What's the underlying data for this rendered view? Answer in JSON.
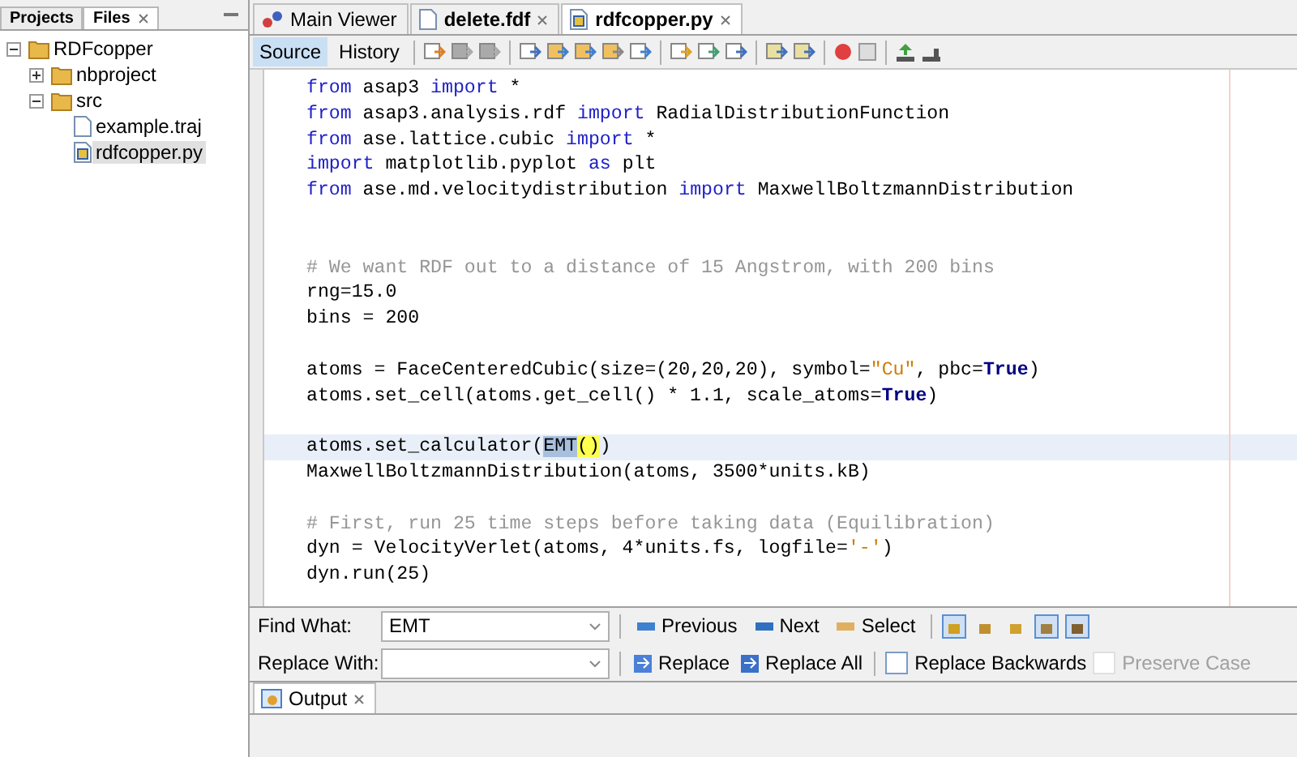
{
  "sidebar": {
    "tabs": [
      {
        "label": "Projects",
        "selected": false,
        "closable": false
      },
      {
        "label": "Files",
        "selected": true,
        "closable": true
      }
    ],
    "tree": [
      {
        "label": "RDFcopper",
        "kind": "folder",
        "expanded": true,
        "selected": false,
        "children": [
          {
            "label": "nbproject",
            "kind": "folder",
            "expanded": false,
            "selected": false
          },
          {
            "label": "src",
            "kind": "folder",
            "expanded": true,
            "selected": false,
            "children": [
              {
                "label": "example.traj",
                "kind": "file",
                "selected": false
              },
              {
                "label": "rdfcopper.py",
                "kind": "python",
                "selected": true
              }
            ]
          }
        ]
      }
    ]
  },
  "editor_tabs": [
    {
      "label": "Main Viewer",
      "kind": "viewer",
      "selected": false
    },
    {
      "label": "delete.fdf",
      "kind": "file",
      "selected": false
    },
    {
      "label": "rdfcopper.py",
      "kind": "python",
      "selected": true
    }
  ],
  "view_tabs": [
    {
      "label": "Source",
      "selected": true
    },
    {
      "label": "History",
      "selected": false
    }
  ],
  "code": [
    {
      "current": false,
      "segments": [
        {
          "kind": "kw",
          "text": "from"
        },
        {
          "kind": "plain",
          "text": " asap3 "
        },
        {
          "kind": "kw",
          "text": "import"
        },
        {
          "kind": "plain",
          "text": " *"
        }
      ]
    },
    {
      "current": false,
      "segments": [
        {
          "kind": "kw",
          "text": "from"
        },
        {
          "kind": "plain",
          "text": " asap3.analysis.rdf "
        },
        {
          "kind": "kw",
          "text": "import"
        },
        {
          "kind": "plain",
          "text": " RadialDistributionFunction"
        }
      ]
    },
    {
      "current": false,
      "segments": [
        {
          "kind": "kw",
          "text": "from"
        },
        {
          "kind": "plain",
          "text": " ase.lattice.cubic "
        },
        {
          "kind": "kw",
          "text": "import"
        },
        {
          "kind": "plain",
          "text": " *"
        }
      ]
    },
    {
      "current": false,
      "segments": [
        {
          "kind": "kw",
          "text": "import"
        },
        {
          "kind": "plain",
          "text": " matplotlib.pyplot "
        },
        {
          "kind": "kw",
          "text": "as"
        },
        {
          "kind": "plain",
          "text": " plt"
        }
      ]
    },
    {
      "current": false,
      "segments": [
        {
          "kind": "kw",
          "text": "from"
        },
        {
          "kind": "plain",
          "text": " ase.md.velocitydistribution "
        },
        {
          "kind": "kw",
          "text": "import"
        },
        {
          "kind": "plain",
          "text": " MaxwellBoltzmannDistribution"
        }
      ]
    },
    {
      "current": false
    },
    {
      "current": false
    },
    {
      "current": false,
      "segments": [
        {
          "kind": "comment",
          "text": "# We want RDF out to a distance of 15 Angstrom, with 200 bins"
        }
      ]
    },
    {
      "current": false,
      "segments": [
        {
          "kind": "plain",
          "text": "rng=15.0"
        }
      ]
    },
    {
      "current": false,
      "segments": [
        {
          "kind": "plain",
          "text": "bins = 200"
        }
      ]
    },
    {
      "current": false
    },
    {
      "current": false,
      "segments": [
        {
          "kind": "plain",
          "text": "atoms = FaceCenteredCubic(size=(20,20,20), symbol="
        },
        {
          "kind": "string",
          "text": "\"Cu\""
        },
        {
          "kind": "plain",
          "text": ", pbc="
        },
        {
          "kind": "bool",
          "text": "True"
        },
        {
          "kind": "plain",
          "text": ")"
        }
      ]
    },
    {
      "current": false,
      "segments": [
        {
          "kind": "plain",
          "text": "atoms.set_cell(atoms.get_cell() * 1.1, scale_atoms="
        },
        {
          "kind": "bool",
          "text": "True"
        },
        {
          "kind": "plain",
          "text": ")"
        }
      ]
    },
    {
      "current": false
    },
    {
      "current": true,
      "segments": [
        {
          "kind": "plain",
          "text": "atoms.set_calculator("
        },
        {
          "kind": "match",
          "text": "EMT"
        },
        {
          "kind": "brace",
          "text": "()"
        },
        {
          "kind": "plain",
          "text": ")"
        }
      ]
    },
    {
      "current": false,
      "segments": [
        {
          "kind": "plain",
          "text": "MaxwellBoltzmannDistribution(atoms, 3500*units.kB)"
        }
      ]
    },
    {
      "current": false
    },
    {
      "current": false,
      "segments": [
        {
          "kind": "comment",
          "text": "# First, run 25 time steps before taking data (Equilibration)"
        }
      ]
    },
    {
      "current": false,
      "segments": [
        {
          "kind": "plain",
          "text": "dyn = VelocityVerlet(atoms, 4*units.fs, logfile="
        },
        {
          "kind": "string",
          "text": "'-'"
        },
        {
          "kind": "plain",
          "text": ")"
        }
      ]
    },
    {
      "current": false,
      "segments": [
        {
          "kind": "plain",
          "text": "dyn.run(25)"
        }
      ]
    }
  ],
  "find_bar": {
    "find_label": "Find What:",
    "find_value": "EMT",
    "replace_label": "Replace With:",
    "find_buttons": [
      {
        "label": "Previous",
        "kind": "up"
      },
      {
        "label": "Next",
        "kind": "down"
      },
      {
        "label": "Select",
        "kind": "select"
      }
    ],
    "toggles": [
      {
        "kind": "match-case",
        "selected": true
      },
      {
        "kind": "whole-word",
        "selected": false
      },
      {
        "kind": "regex",
        "selected": false
      },
      {
        "kind": "highlight",
        "selected": true
      },
      {
        "kind": "wrap",
        "selected": true
      }
    ],
    "replace_buttons": [
      {
        "label": "Replace",
        "kind": "one"
      },
      {
        "label": "Replace All",
        "kind": "all"
      }
    ],
    "options": [
      {
        "label": "Replace Backwards",
        "checked": false,
        "disabled": false
      },
      {
        "label": "Preserve Case",
        "checked": false,
        "disabled": true
      }
    ]
  },
  "output_tab": {
    "label": "Output",
    "selected": true
  }
}
